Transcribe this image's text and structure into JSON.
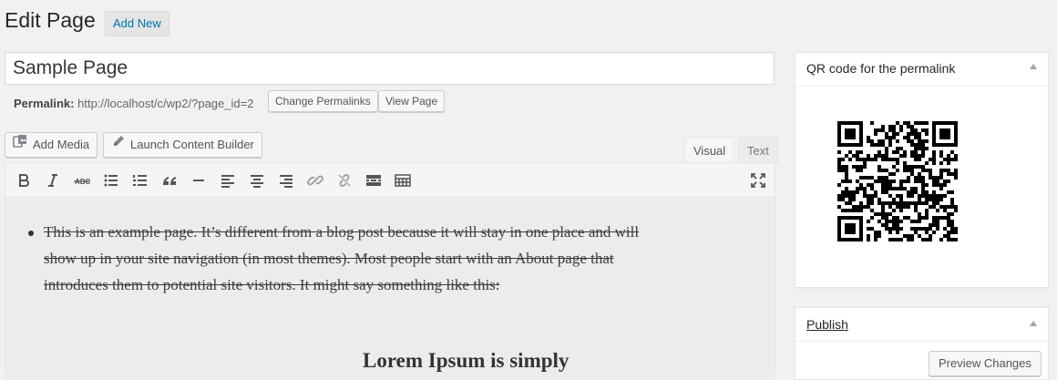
{
  "header": {
    "title": "Edit Page",
    "add_new": "Add New"
  },
  "post": {
    "title": "Sample Page"
  },
  "permalink": {
    "label": "Permalink:",
    "url": "http://localhost/c/wp2/?page_id=2",
    "change_button": "Change Permalinks",
    "view_button": "View Page"
  },
  "media_buttons": {
    "add_media": "Add Media",
    "launch_builder": "Launch Content Builder"
  },
  "editor_tabs": {
    "visual": "Visual",
    "text": "Text",
    "active": "Visual"
  },
  "toolbar": {
    "buttons": [
      "bold-icon",
      "italic-icon",
      "strikethrough-icon",
      "bullet-list-icon",
      "numbered-list-icon",
      "blockquote-icon",
      "horizontal-rule-icon",
      "align-left-icon",
      "align-center-icon",
      "align-right-icon",
      "link-icon",
      "unlink-icon",
      "read-more-icon",
      "toolbar-toggle-icon",
      "fullscreen-icon"
    ]
  },
  "content": {
    "paragraph": "This is an example page. It’s different from a blog post because it will stay in one place and will show up in your site navigation (in most themes). Most people start with an About page that introduces them to potential site visitors. It might say something like this:",
    "heading": "Lorem Ipsum is simply"
  },
  "sidebar": {
    "qr_box": {
      "title": "QR code for the permalink"
    },
    "publish_box": {
      "title": "Publish",
      "preview_button": "Preview Changes"
    }
  }
}
